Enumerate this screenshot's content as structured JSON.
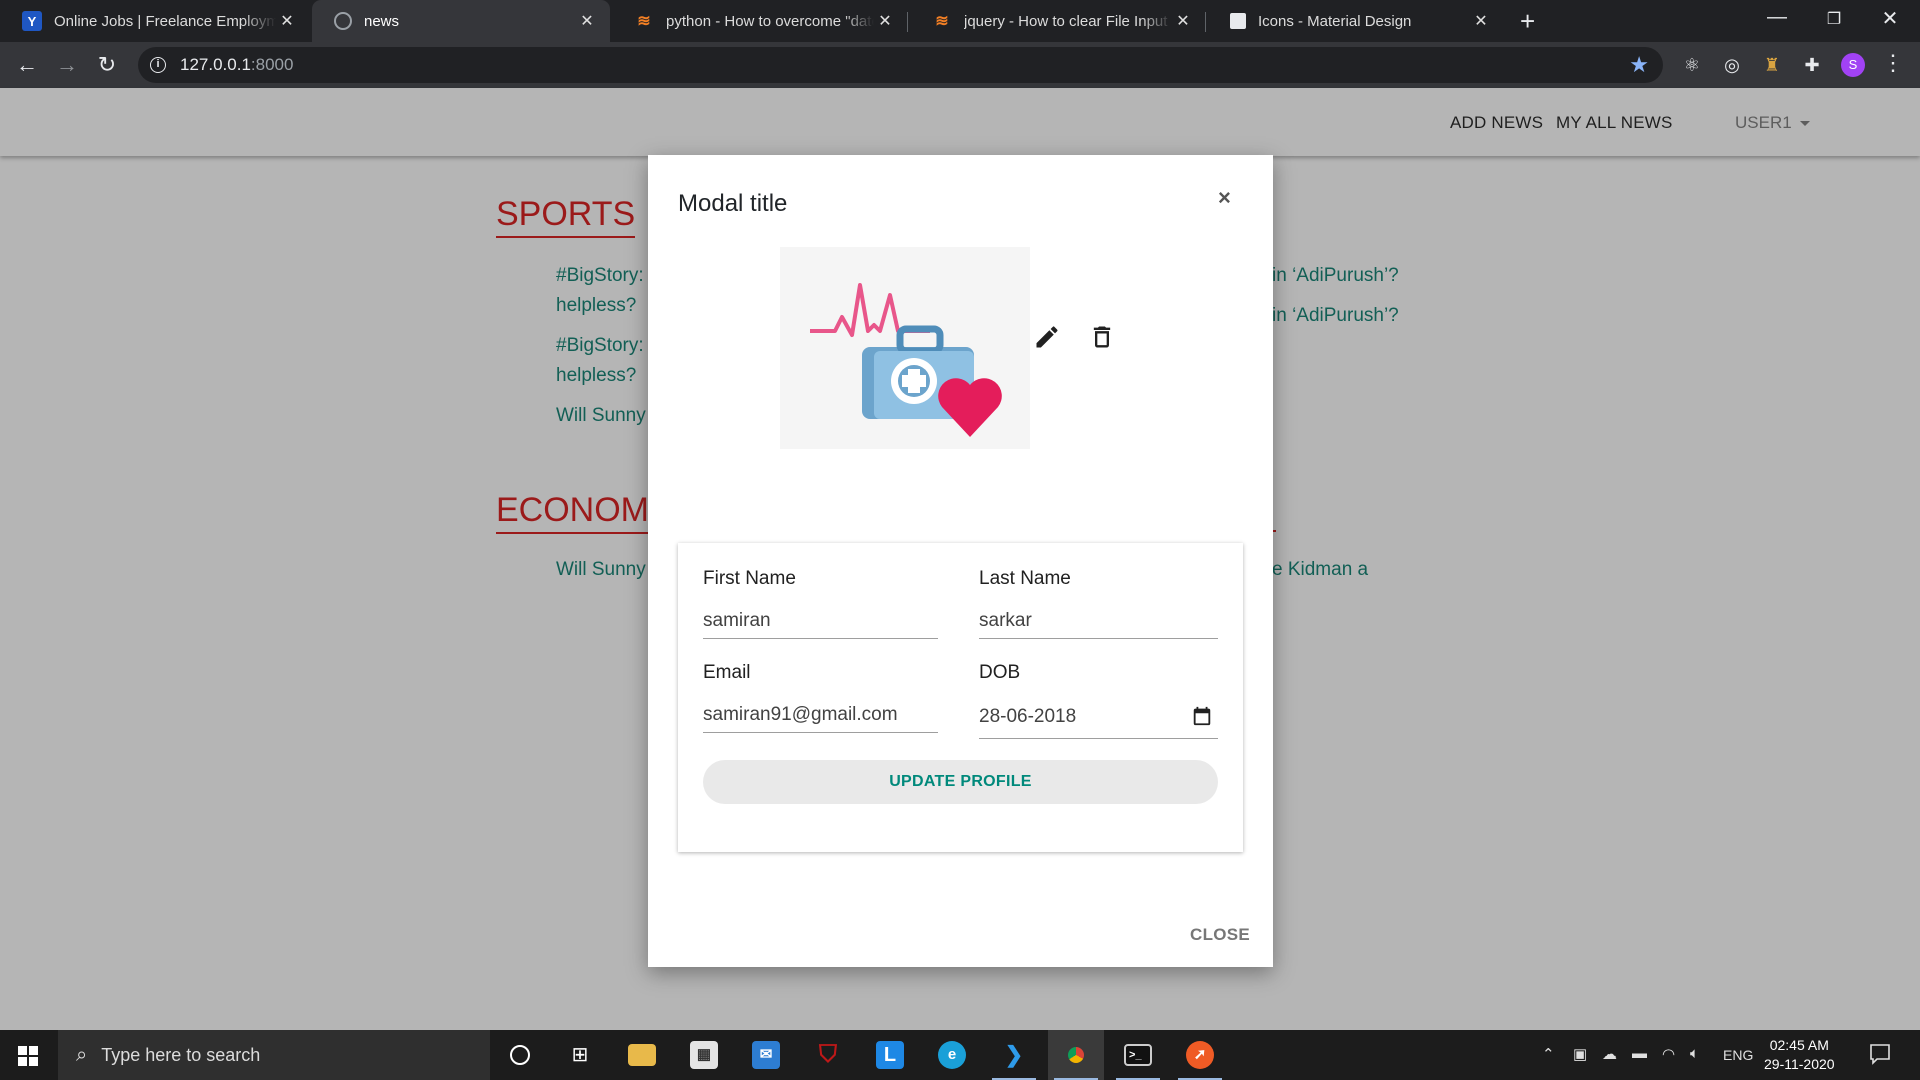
{
  "browser": {
    "tabs": [
      {
        "title": "Online Jobs | Freelance Employment",
        "icon": "upwork-icon"
      },
      {
        "title": "news",
        "icon": "globe-icon",
        "active": true
      },
      {
        "title": "python - How to overcome \"datetime",
        "icon": "stackoverflow-icon"
      },
      {
        "title": "jquery - How to clear File Input - Sta",
        "icon": "stackoverflow-icon"
      },
      {
        "title": "Icons - Material Design",
        "icon": "material-icon"
      }
    ],
    "url_host": "127.0.0.1",
    "url_port": ":8000",
    "profile_initial": "S"
  },
  "site": {
    "nav": {
      "add_news": "ADD NEWS",
      "my_all_news": "MY ALL NEWS",
      "user": "USER1"
    },
    "sections": [
      {
        "title": "SPORTS"
      },
      {
        "title": "ECONOMY"
      }
    ],
    "visible_fragments": {
      "sports_1_line1": "#BigStory:",
      "sports_1_line2": "helpless?",
      "sports_2_line1": "#BigStory:",
      "sports_2_line2": "helpless?",
      "sports_3": "Will Sunny",
      "economy_1": "Will Sunny",
      "right_1": "in ‘AdiPurush’?",
      "right_2": "in ‘AdiPurush’?",
      "right_3": "e Kidman a"
    }
  },
  "modal": {
    "title": "Modal title",
    "close_x": "×",
    "form": {
      "first_name_label": "First Name",
      "first_name_value": "samiran",
      "last_name_label": "Last Name",
      "last_name_value": "sarkar",
      "email_label": "Email",
      "email_value": "samiran91@gmail.com",
      "dob_label": "DOB",
      "dob_value": "28-06-2018",
      "submit_label": "UPDATE PROFILE"
    },
    "close_label": "CLOSE"
  },
  "taskbar": {
    "search_placeholder": "Type here to search",
    "language": "ENG",
    "time": "02:45 AM",
    "date": "29-11-2020"
  },
  "colors": {
    "accent_teal": "#00897b",
    "section_red": "#9b1a1a",
    "news_teal": "#125f55"
  }
}
